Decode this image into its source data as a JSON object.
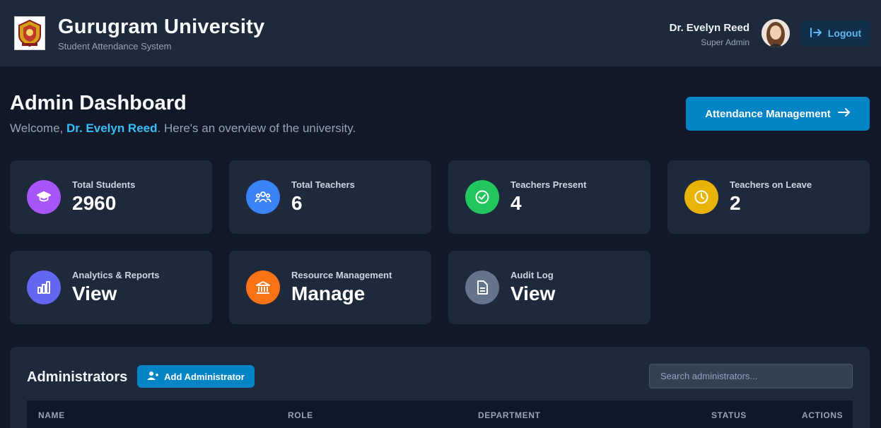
{
  "header": {
    "title": "Gurugram University",
    "subtitle": "Student Attendance System",
    "user_name": "Dr. Evelyn Reed",
    "user_role": "Super Admin",
    "logout_label": "Logout"
  },
  "page": {
    "title": "Admin Dashboard",
    "welcome_prefix": "Welcome, ",
    "welcome_name": "Dr. Evelyn Reed",
    "welcome_suffix": ". Here's an overview of the university.",
    "attendance_button": "Attendance Management"
  },
  "stats": [
    {
      "label": "Total Students",
      "value": "2960",
      "icon": "graduation-cap-icon",
      "color": "#a855f7"
    },
    {
      "label": "Total Teachers",
      "value": "6",
      "icon": "users-icon",
      "color": "#3b82f6"
    },
    {
      "label": "Teachers Present",
      "value": "4",
      "icon": "check-circle-icon",
      "color": "#22c55e"
    },
    {
      "label": "Teachers on Leave",
      "value": "2",
      "icon": "clock-icon",
      "color": "#eab308"
    }
  ],
  "actions": [
    {
      "label": "Analytics & Reports",
      "value": "View",
      "icon": "bar-chart-icon",
      "color": "#6366f1"
    },
    {
      "label": "Resource Management",
      "value": "Manage",
      "icon": "building-icon",
      "color": "#f97316"
    },
    {
      "label": "Audit Log",
      "value": "View",
      "icon": "document-icon",
      "color": "#64748b"
    }
  ],
  "administrators": {
    "title": "Administrators",
    "add_label": "Add Administrator",
    "search_placeholder": "Search administrators...",
    "columns": [
      "NAME",
      "ROLE",
      "DEPARTMENT",
      "STATUS",
      "ACTIONS"
    ]
  }
}
